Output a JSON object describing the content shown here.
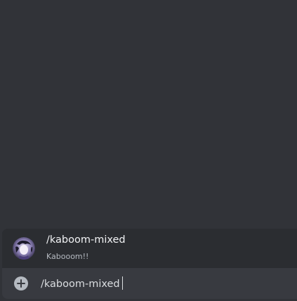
{
  "autocomplete": {
    "command": "/kaboom-mixed",
    "description": "Kabooom!!",
    "avatar_icon": "bot-avatar"
  },
  "composer": {
    "value": "/kaboom-mixed",
    "add_icon": "plus-circle-icon"
  },
  "colors": {
    "background": "#313338",
    "autocomplete_bg": "#2b2d31",
    "composer_bg": "#383a40",
    "text_primary": "#f2f3f5",
    "text_muted": "#b5bac1"
  }
}
